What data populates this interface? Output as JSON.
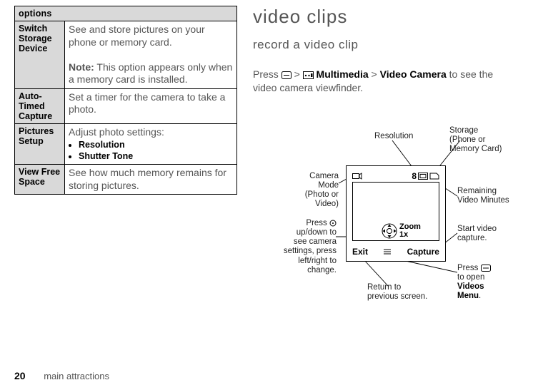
{
  "options_table": {
    "header": "options",
    "rows": [
      {
        "name": "Switch Storage Device",
        "desc": "See and store pictures on your phone or memory card.",
        "note_label": "Note:",
        "note": "This option appears only when a memory card is installed."
      },
      {
        "name": "Auto-Timed Capture",
        "desc": "Set a timer for the camera to take a photo."
      },
      {
        "name": "Pictures Setup",
        "desc_intro": "Adjust photo settings:",
        "bullets": [
          "Resolution",
          "Shutter Tone"
        ]
      },
      {
        "name": "View Free Space",
        "desc": "See how much memory remains for storing pictures."
      }
    ]
  },
  "right_column": {
    "title": "video clips",
    "subtitle": "record a video clip",
    "para_parts": {
      "p1": "Press ",
      "gt1": " > ",
      "mm": " Multimedia",
      "gt2": " > ",
      "vc": "Video Camera",
      "p2": " to see the video camera viewfinder."
    }
  },
  "diagram": {
    "status_eight": "8",
    "zoom_line1": "Zoom",
    "zoom_line2": "1x",
    "soft_left": "Exit",
    "soft_right": "Capture",
    "callouts": {
      "resolution": "Resolution",
      "storage1": "Storage",
      "storage2": "(Phone or",
      "storage3": "Memory Card)",
      "cammode1": "Camera Mode",
      "cammode2": "(Photo or",
      "cammode3": "Video)",
      "rem1": "Remaining",
      "rem2": "Video Minutes",
      "nav1": "Press ",
      "nav2": "up/down to",
      "nav3": "see camera",
      "nav4": "settings, press",
      "nav5": "left/right to",
      "nav6": "change.",
      "start1": "Start video",
      "start2": "capture.",
      "menu1": "Press ",
      "menu2": "to open ",
      "menu3": "Videos",
      "menu4": "Menu",
      "menu5": ".",
      "ret1": "Return to",
      "ret2": "previous screen."
    }
  },
  "footer": {
    "page": "20",
    "section": "main attractions"
  }
}
